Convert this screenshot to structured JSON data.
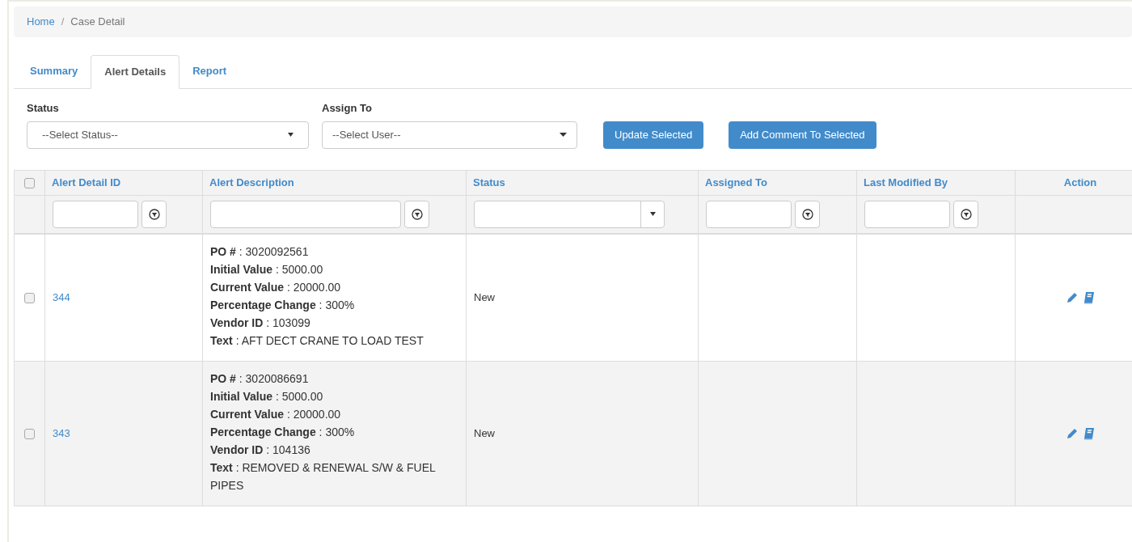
{
  "breadcrumb": [
    {
      "label": "Home",
      "kind": "link"
    },
    {
      "label": "/",
      "kind": "separator"
    },
    {
      "label": "Case Detail",
      "kind": "current"
    }
  ],
  "tabs": [
    {
      "label": "Summary",
      "selected": false
    },
    {
      "label": "Alert Details",
      "selected": true
    },
    {
      "label": "Report",
      "selected": false
    }
  ],
  "filters": {
    "status": {
      "label": "Status",
      "placeholder": "--Select Status--"
    },
    "assign_to": {
      "label": "Assign To",
      "placeholder": "--Select User--"
    }
  },
  "buttons": [
    "Update Selected",
    "Add Comment To Selected"
  ],
  "table": {
    "select_all_checked": false,
    "columns": [
      {
        "label": "Alert Detail ID",
        "kind": "text"
      },
      {
        "label": "Alert Description",
        "kind": "text"
      },
      {
        "label": "Status",
        "kind": "select"
      },
      {
        "label": "Assigned To",
        "kind": "text"
      },
      {
        "label": "Last Modified By",
        "kind": "text"
      },
      {
        "label": "Action",
        "kind": "none"
      }
    ],
    "rows": [
      {
        "checked": false,
        "id": "344",
        "description": [
          "**PO #** : 3020092561",
          "**Initial Value** : 5000.00",
          "**Current Value** : 20000.00",
          "**Percentage Change** : 300%",
          "**Vendor ID** : 103099",
          "**Text** : AFT DECT CRANE TO LOAD TEST"
        ],
        "status": "New"
      },
      {
        "checked": false,
        "id": "343",
        "description": [
          "**PO #** : 3020086691",
          "**Initial Value** : 5000.00",
          "**Current Value** : 20000.00",
          "**Percentage Change** : 300%",
          "**Vendor ID** : 104136",
          "**Text** : REMOVED & RENEWAL S/W & FUEL PIPES"
        ],
        "status": "New"
      }
    ]
  }
}
